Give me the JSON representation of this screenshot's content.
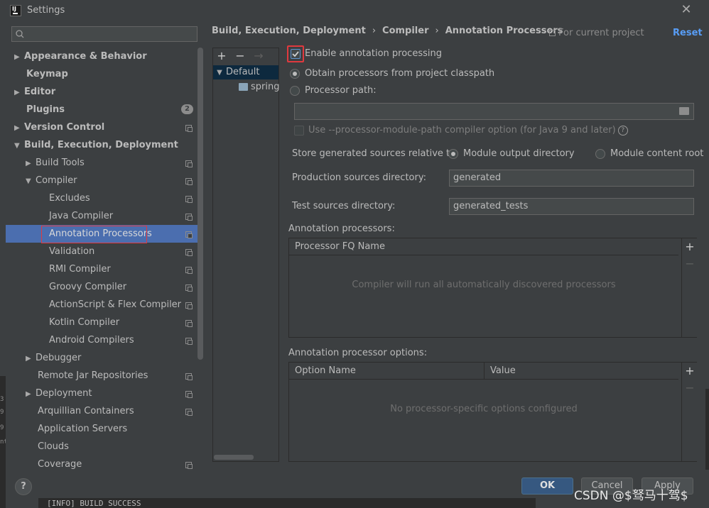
{
  "window": {
    "title": "Settings",
    "close_glyph": "✕"
  },
  "search": {
    "placeholder": "",
    "value": ""
  },
  "sidebar": {
    "items": [
      {
        "label": "Appearance & Behavior",
        "bold": true,
        "arrow": "▶"
      },
      {
        "label": "Keymap",
        "bold": true
      },
      {
        "label": "Editor",
        "bold": true,
        "arrow": "▶"
      },
      {
        "label": "Plugins",
        "bold": true,
        "badge": "2"
      },
      {
        "label": "Version Control",
        "bold": true,
        "arrow": "▶"
      },
      {
        "label": "Build, Execution, Deployment",
        "bold": true,
        "arrow": "▼"
      },
      {
        "label": "Build Tools",
        "arrow": "▶"
      },
      {
        "label": "Compiler",
        "arrow": "▼"
      },
      {
        "label": "Excludes"
      },
      {
        "label": "Java Compiler"
      },
      {
        "label": "Annotation Processors",
        "selected": true
      },
      {
        "label": "Validation"
      },
      {
        "label": "RMI Compiler"
      },
      {
        "label": "Groovy Compiler"
      },
      {
        "label": "ActionScript & Flex Compiler"
      },
      {
        "label": "Kotlin Compiler"
      },
      {
        "label": "Android Compilers"
      },
      {
        "label": "Debugger",
        "arrow": "▶"
      },
      {
        "label": "Remote Jar Repositories"
      },
      {
        "label": "Deployment",
        "arrow": "▶"
      },
      {
        "label": "Arquillian Containers"
      },
      {
        "label": "Application Servers"
      },
      {
        "label": "Clouds"
      },
      {
        "label": "Coverage"
      }
    ]
  },
  "breadcrumb": {
    "items": [
      "Build, Execution, Deployment",
      "Compiler",
      "Annotation Processors"
    ],
    "separator": "›"
  },
  "header": {
    "for_project": "For current project",
    "reset": "Reset"
  },
  "profiles": {
    "toolbar": {
      "add": "+",
      "remove": "−",
      "move": "→"
    },
    "default_arrow": "▼",
    "default": "Default",
    "child": "spring"
  },
  "settings": {
    "enable_processing": {
      "label": "Enable annotation processing",
      "checked": true
    },
    "obtain_from_classpath": {
      "label": "Obtain processors from project classpath",
      "selected": true
    },
    "processor_path": {
      "label": "Processor path:",
      "selected": false,
      "value": ""
    },
    "module_path_option": {
      "label": "Use --processor-module-path compiler option (for Java 9 and later)",
      "checked": false,
      "help_glyph": "?"
    },
    "store_relative": {
      "label": "Store generated sources relative to:",
      "options": [
        {
          "label": "Module output directory",
          "selected": true
        },
        {
          "label": "Module content root",
          "selected": false
        }
      ]
    },
    "production_dir": {
      "label": "Production sources directory:",
      "value": "generated"
    },
    "test_dir": {
      "label": "Test sources directory:",
      "value": "generated_tests"
    }
  },
  "processors_table": {
    "title": "Annotation processors:",
    "columns": [
      "Processor FQ Name"
    ],
    "empty_text": "Compiler will run all automatically discovered processors",
    "add": "+",
    "remove": "−"
  },
  "options_table": {
    "title": "Annotation processor options:",
    "columns": [
      "Option Name",
      "Value"
    ],
    "empty_text": "No processor-specific options configured",
    "add": "+",
    "remove": "−"
  },
  "footer": {
    "help": "?",
    "ok": "OK",
    "cancel": "Cancel",
    "apply": "Apply"
  },
  "background": {
    "console_line": "[INFO] BUILD SUCCESS",
    "left_strip_chars": [
      "3",
      "9",
      "9",
      "nt"
    ]
  },
  "watermark": "CSDN @$驽马十驾$",
  "colors": {
    "accent": "#4b6eaf",
    "highlight_outline": "#e0393e",
    "link": "#589df6",
    "primary_button": "#365880"
  }
}
